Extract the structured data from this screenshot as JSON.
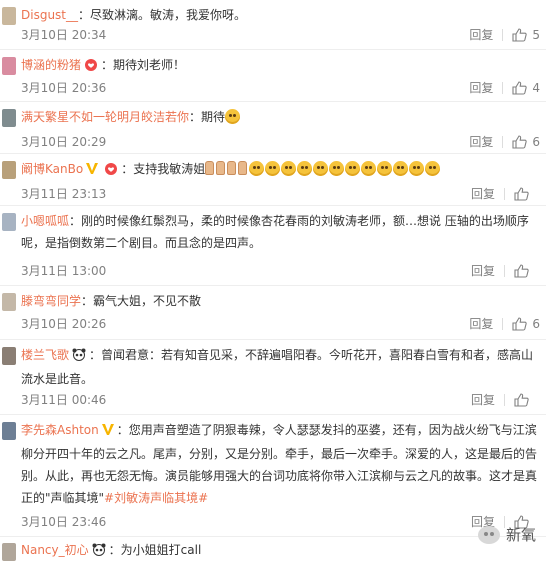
{
  "labels": {
    "reply": "回复",
    "colon": "："
  },
  "colors": {
    "username": "#eb7350",
    "meta": "#808080",
    "vip_badge": "#f7b500",
    "heart_badge": "#f04848"
  },
  "comments": [
    {
      "user": "Disgust__",
      "text": "尽致淋漓。敏涛，我爱你呀。",
      "time": "3月10日 20:34",
      "likes": "5"
    },
    {
      "user": "博涵的粉猪",
      "text": "期待刘老师！",
      "time": "3月10日 20:36",
      "likes": "4"
    },
    {
      "user": "满天繁星不如一轮明月皎洁若你",
      "text": "期待",
      "time": "3月10日 20:29",
      "likes": "6"
    },
    {
      "user": "阚博KanBo",
      "text": "支持我敏涛姐",
      "time": "3月11日 23:13",
      "likes": ""
    },
    {
      "user": "小嗯呱呱",
      "text": "刚的时候像红鬃烈马，柔的时候像杏花春雨的刘敏涛老师，额…想说  压轴的出场顺序呢，是指倒数第二个剧目。而且念的是四声。",
      "time": "3月11日 13:00",
      "likes": ""
    },
    {
      "user": "滕弯弯同学",
      "text": "霸气大姐，不见不散",
      "time": "3月10日 20:26",
      "likes": "6"
    },
    {
      "user": "楼兰飞歌",
      "text": "曾闻君意：若有知音见采，不辞遍唱阳春。今听花开，喜阳春白雪有和者，感高山流水是此音。",
      "time": "3月11日 00:46",
      "likes": ""
    },
    {
      "user": "李先森Ashton",
      "text": "您用声音塑造了阴狠毒辣，令人瑟瑟发抖的巫婆，还有，因为战火纷飞与江滨柳分开四十年的云之凡。尾声，分别，又是分别。牵手，最后一次牵手。深爱的人，这是最后的告别。从此，再也无怨无悔。演员能够用强大的台词功底将你带入江滨柳与云之凡的故事。这才是真正的\"声临其境\"",
      "hashtag": "#刘敏涛声临其境#",
      "time": "3月10日 23:46",
      "likes": ""
    },
    {
      "user": "Nancy_初心",
      "text": "为小姐姐打call"
    }
  ],
  "watermark": {
    "text": "新氧",
    "icon": "chat-bubble-icon"
  }
}
